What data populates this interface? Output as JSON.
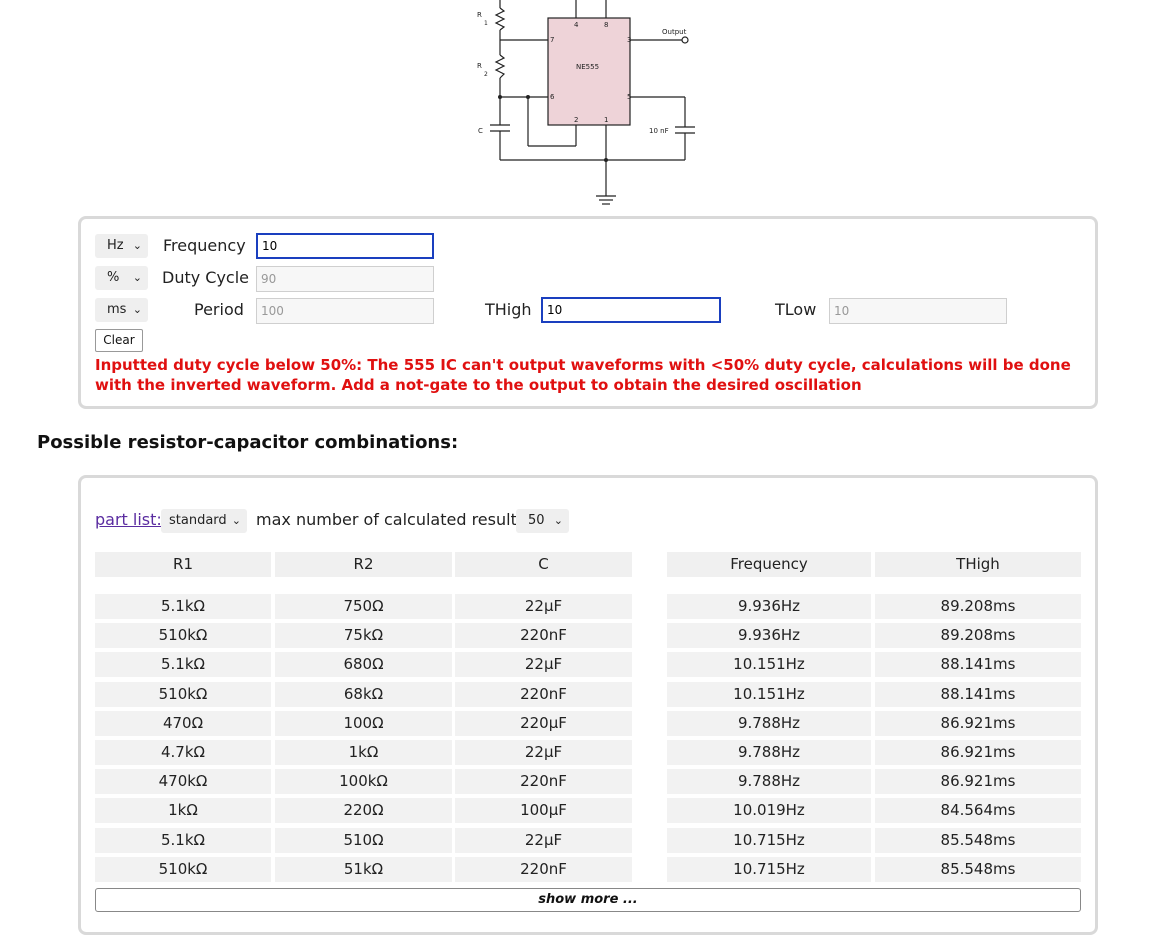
{
  "schematic": {
    "r1_label": "R",
    "r1_sub": "1",
    "r2_label": "R",
    "r2_sub": "2",
    "c_label": "C",
    "ic_label": "NE555",
    "pin4": "4",
    "pin8": "8",
    "pin7": "7",
    "pin3": "3",
    "pin6": "6",
    "pin5": "5",
    "pin2": "2",
    "pin1": "1",
    "output_label": "Output",
    "cap_label": "10 nF"
  },
  "controls": {
    "freq_unit": "Hz",
    "duty_unit": "%",
    "period_unit": "ms",
    "frequency_label": "Frequency",
    "frequency_value": "10",
    "duty_label": "Duty Cycle",
    "duty_value": "90",
    "period_label": "Period",
    "period_value": "100",
    "thigh_label": "THigh",
    "thigh_value": "10",
    "tlow_label": "TLow",
    "tlow_value": "10",
    "clear_label": "Clear",
    "warning": "Inputted duty cycle below 50%: The 555 IC can't output waveforms with <50% duty cycle, calculations will be done with the inverted waveform. Add a not-gate to the output to obtain the desired oscillation"
  },
  "results": {
    "heading": "Possible resistor-capacitor combinations:",
    "part_list_label": "part list:",
    "part_list_value": "standard",
    "max_label": "max number of calculated results:",
    "max_value": "50",
    "headers": [
      "R1",
      "R2",
      "C",
      "Frequency",
      "THigh"
    ],
    "rows": [
      [
        "5.1kΩ",
        "750Ω",
        "22µF",
        "9.936Hz",
        "89.208ms"
      ],
      [
        "510kΩ",
        "75kΩ",
        "220nF",
        "9.936Hz",
        "89.208ms"
      ],
      [
        "5.1kΩ",
        "680Ω",
        "22µF",
        "10.151Hz",
        "88.141ms"
      ],
      [
        "510kΩ",
        "68kΩ",
        "220nF",
        "10.151Hz",
        "88.141ms"
      ],
      [
        "470Ω",
        "100Ω",
        "220µF",
        "9.788Hz",
        "86.921ms"
      ],
      [
        "4.7kΩ",
        "1kΩ",
        "22µF",
        "9.788Hz",
        "86.921ms"
      ],
      [
        "470kΩ",
        "100kΩ",
        "220nF",
        "9.788Hz",
        "86.921ms"
      ],
      [
        "1kΩ",
        "220Ω",
        "100µF",
        "10.019Hz",
        "84.564ms"
      ],
      [
        "5.1kΩ",
        "510Ω",
        "22µF",
        "10.715Hz",
        "85.548ms"
      ],
      [
        "510kΩ",
        "51kΩ",
        "220nF",
        "10.715Hz",
        "85.548ms"
      ]
    ],
    "show_more": "show more ..."
  },
  "colors": {
    "accent": "#1a3fbf",
    "warning": "#e01010",
    "ic_fill": "#eed3d8"
  }
}
